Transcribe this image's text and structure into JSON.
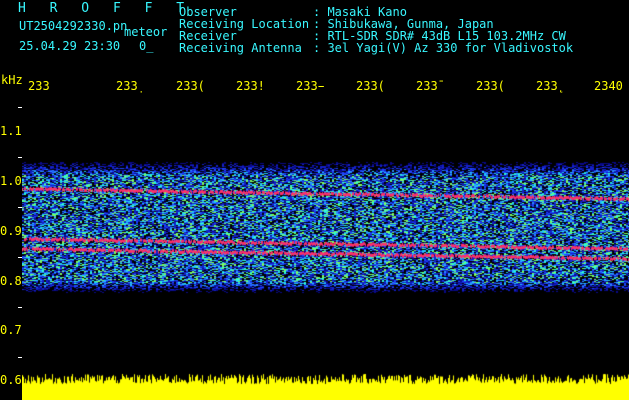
{
  "header": {
    "title": "H R O F F T",
    "filename": "UT2504292330.pn",
    "meteor_label": "meteor",
    "datetime": "25.04.29 23:30",
    "counter": "0_",
    "fields": [
      {
        "label": "Observer",
        "value": ": Masaki Kano"
      },
      {
        "label": "Receiving Location",
        "value": ": Shibukawa, Gunma, Japan"
      },
      {
        "label": "Receiver",
        "value": ": RTL-SDR SDR# 43dB L15 103.2MHz CW"
      },
      {
        "label": "Receiving Antenna",
        "value": ": 3el Yagi(V) Az 330 for Vladivostok"
      }
    ]
  },
  "axis": {
    "unit": "kHz",
    "y_ticks": [
      "1.1",
      "1.0",
      "0.9",
      "0.8",
      "0.7",
      "0.6"
    ],
    "x_ticks": [
      "233",
      "233̣",
      "233(",
      "233!",
      "233̵",
      "233(",
      "233̄",
      "233(",
      "233˛",
      "2340"
    ]
  },
  "colors": {
    "header_text": "#38f7ff",
    "axis_text": "#ffff00",
    "echo_line": "#ff2f6a",
    "noise_floor": "#ffff00",
    "background": "#000000"
  },
  "plot": {
    "echo_lines_khz": [
      0.985,
      0.885,
      0.865
    ],
    "signal_band_khz": [
      0.77,
      1.05
    ]
  }
}
